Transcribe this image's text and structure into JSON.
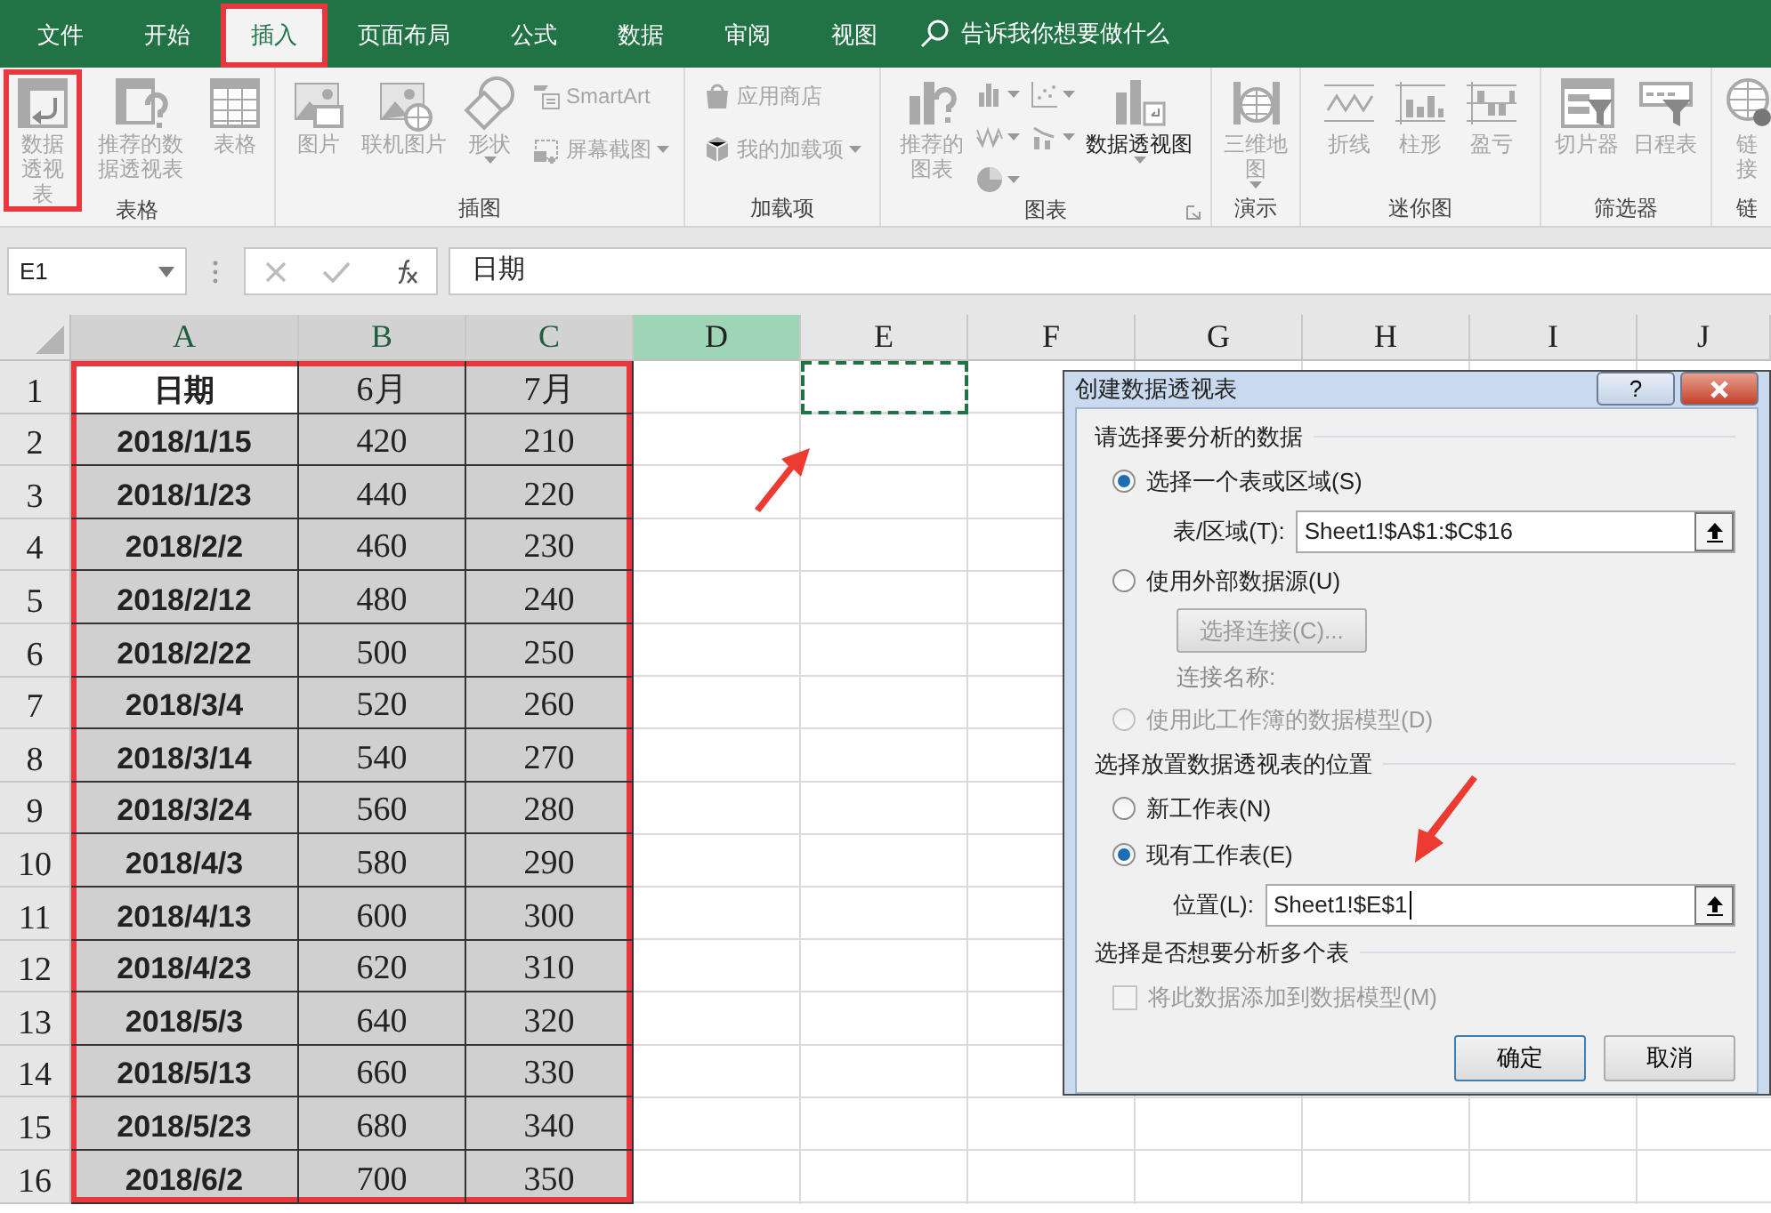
{
  "tabs": [
    {
      "label": "文件",
      "selected": false,
      "highlighted": false
    },
    {
      "label": "开始",
      "selected": false,
      "highlighted": false
    },
    {
      "label": "插入",
      "selected": true,
      "highlighted": true
    },
    {
      "label": "页面布局",
      "selected": false,
      "highlighted": false
    },
    {
      "label": "公式",
      "selected": false,
      "highlighted": false
    },
    {
      "label": "数据",
      "selected": false,
      "highlighted": false
    },
    {
      "label": "审阅",
      "selected": false,
      "highlighted": false
    },
    {
      "label": "视图",
      "selected": false,
      "highlighted": false
    }
  ],
  "search": {
    "placeholder": "告诉我你想要做什么"
  },
  "ribbon": [
    {
      "label": "表格",
      "items": [
        {
          "kind": "large",
          "label": "数据透视表",
          "disabled": true,
          "highlighted": true
        },
        {
          "kind": "large",
          "label": "推荐的数据透视表",
          "disabled": true
        },
        {
          "kind": "large",
          "label": "表格",
          "disabled": true
        }
      ]
    },
    {
      "label": "插图",
      "items": [
        {
          "kind": "large",
          "label": "图片",
          "disabled": true
        },
        {
          "kind": "large",
          "label": "联机图片",
          "disabled": true
        },
        {
          "kind": "large",
          "label": "形状",
          "disabled": true,
          "dropdown": true
        },
        {
          "kind": "small",
          "label": "SmartArt",
          "disabled": true
        },
        {
          "kind": "small",
          "label": "屏幕截图",
          "disabled": true,
          "dropdown": true
        }
      ]
    },
    {
      "label": "加载项",
      "items": [
        {
          "kind": "small",
          "label": "应用商店",
          "disabled": true
        },
        {
          "kind": "small",
          "label": "我的加载项",
          "disabled": true,
          "dropdown": true
        }
      ]
    },
    {
      "label": "图表",
      "launcher": true,
      "items": [
        {
          "kind": "large",
          "label": "推荐的图表",
          "disabled": true
        },
        {
          "kind": "icon",
          "disabled": true,
          "dropdown": true
        },
        {
          "kind": "icon",
          "disabled": true,
          "dropdown": true
        },
        {
          "kind": "icon",
          "disabled": true,
          "dropdown": true
        },
        {
          "kind": "icon",
          "disabled": true,
          "dropdown": true
        },
        {
          "kind": "icon",
          "disabled": true,
          "dropdown": true
        },
        {
          "kind": "large",
          "label": "数据透视图",
          "disabled": false,
          "dropdown": true
        }
      ]
    },
    {
      "label": "演示",
      "items": [
        {
          "kind": "large",
          "label": "三维地图",
          "disabled": true,
          "dropdown": true
        }
      ]
    },
    {
      "label": "迷你图",
      "items": [
        {
          "kind": "large",
          "label": "折线",
          "disabled": true
        },
        {
          "kind": "large",
          "label": "柱形",
          "disabled": true
        },
        {
          "kind": "large",
          "label": "盈亏",
          "disabled": true
        }
      ]
    },
    {
      "label": "筛选器",
      "items": [
        {
          "kind": "large",
          "label": "切片器",
          "disabled": true
        },
        {
          "kind": "large",
          "label": "日程表",
          "disabled": true
        }
      ]
    },
    {
      "label": "链",
      "items": [
        {
          "kind": "large",
          "label": "链接",
          "disabled": true
        }
      ]
    }
  ],
  "formula_bar": {
    "name_box": "E1",
    "formula": "日期"
  },
  "sheet": {
    "columns": [
      {
        "label": "A",
        "selected": true,
        "active": false,
        "marquee": false
      },
      {
        "label": "B",
        "selected": true,
        "active": false,
        "marquee": false
      },
      {
        "label": "C",
        "selected": true,
        "active": false,
        "marquee": false
      },
      {
        "label": "D",
        "selected": false,
        "active": true,
        "marquee": false
      },
      {
        "label": "E",
        "selected": false,
        "active": false,
        "marquee": true
      },
      {
        "label": "F",
        "selected": false,
        "active": false,
        "marquee": false
      },
      {
        "label": "G",
        "selected": false,
        "active": false,
        "marquee": false
      },
      {
        "label": "H",
        "selected": false,
        "active": false,
        "marquee": false
      },
      {
        "label": "I",
        "selected": false,
        "active": false,
        "marquee": false
      },
      {
        "label": "J",
        "selected": false,
        "active": false,
        "marquee": false
      }
    ],
    "range_highlighted": true,
    "rows": [
      {
        "number": "1",
        "cells": [
          "日期",
          "6月",
          "7月"
        ]
      },
      {
        "number": "2",
        "cells": [
          "2018/1/15",
          "420",
          "210"
        ]
      },
      {
        "number": "3",
        "cells": [
          "2018/1/23",
          "440",
          "220"
        ]
      },
      {
        "number": "4",
        "cells": [
          "2018/2/2",
          "460",
          "230"
        ]
      },
      {
        "number": "5",
        "cells": [
          "2018/2/12",
          "480",
          "240"
        ]
      },
      {
        "number": "6",
        "cells": [
          "2018/2/22",
          "500",
          "250"
        ]
      },
      {
        "number": "7",
        "cells": [
          "2018/3/4",
          "520",
          "260"
        ]
      },
      {
        "number": "8",
        "cells": [
          "2018/3/14",
          "540",
          "270"
        ]
      },
      {
        "number": "9",
        "cells": [
          "2018/3/24",
          "560",
          "280"
        ]
      },
      {
        "number": "10",
        "cells": [
          "2018/4/3",
          "580",
          "290"
        ]
      },
      {
        "number": "11",
        "cells": [
          "2018/4/13",
          "600",
          "300"
        ]
      },
      {
        "number": "12",
        "cells": [
          "2018/4/23",
          "620",
          "310"
        ]
      },
      {
        "number": "13",
        "cells": [
          "2018/5/3",
          "640",
          "320"
        ]
      },
      {
        "number": "14",
        "cells": [
          "2018/5/13",
          "660",
          "330"
        ]
      },
      {
        "number": "15",
        "cells": [
          "2018/5/23",
          "680",
          "340"
        ]
      },
      {
        "number": "16",
        "cells": [
          "2018/6/2",
          "700",
          "350"
        ]
      }
    ]
  },
  "dialog": {
    "title": "创建数据透视表",
    "help": "?",
    "sections": [
      {
        "heading": "请选择要分析的数据",
        "options": [
          {
            "kind": "radio",
            "label": "选择一个表或区域(S)",
            "selected": true,
            "disabled": false
          },
          {
            "kind": "field",
            "label": "表/区域(T):",
            "value": "Sheet1!$A$1:$C$16",
            "focused": false
          },
          {
            "kind": "radio",
            "label": "使用外部数据源(U)",
            "selected": false,
            "disabled": false
          },
          {
            "kind": "button",
            "label": "选择连接(C)...",
            "disabled": true
          },
          {
            "kind": "note",
            "label": "连接名称:",
            "disabled": true
          },
          {
            "kind": "radio",
            "label": "使用此工作簿的数据模型(D)",
            "selected": false,
            "disabled": true
          }
        ]
      },
      {
        "heading": "选择放置数据透视表的位置",
        "options": [
          {
            "kind": "radio",
            "label": "新工作表(N)",
            "selected": false,
            "disabled": false
          },
          {
            "kind": "radio",
            "label": "现有工作表(E)",
            "selected": true,
            "disabled": false
          },
          {
            "kind": "field",
            "label": "位置(L):",
            "value": "Sheet1!$E$1",
            "focused": true
          }
        ]
      },
      {
        "heading": "选择是否想要分析多个表",
        "options": [
          {
            "kind": "checkbox",
            "label": "将此数据添加到数据模型(M)",
            "checked": false,
            "disabled": true
          }
        ]
      }
    ],
    "buttons": [
      {
        "label": "确定",
        "default": true
      },
      {
        "label": "取消",
        "default": false
      }
    ]
  }
}
